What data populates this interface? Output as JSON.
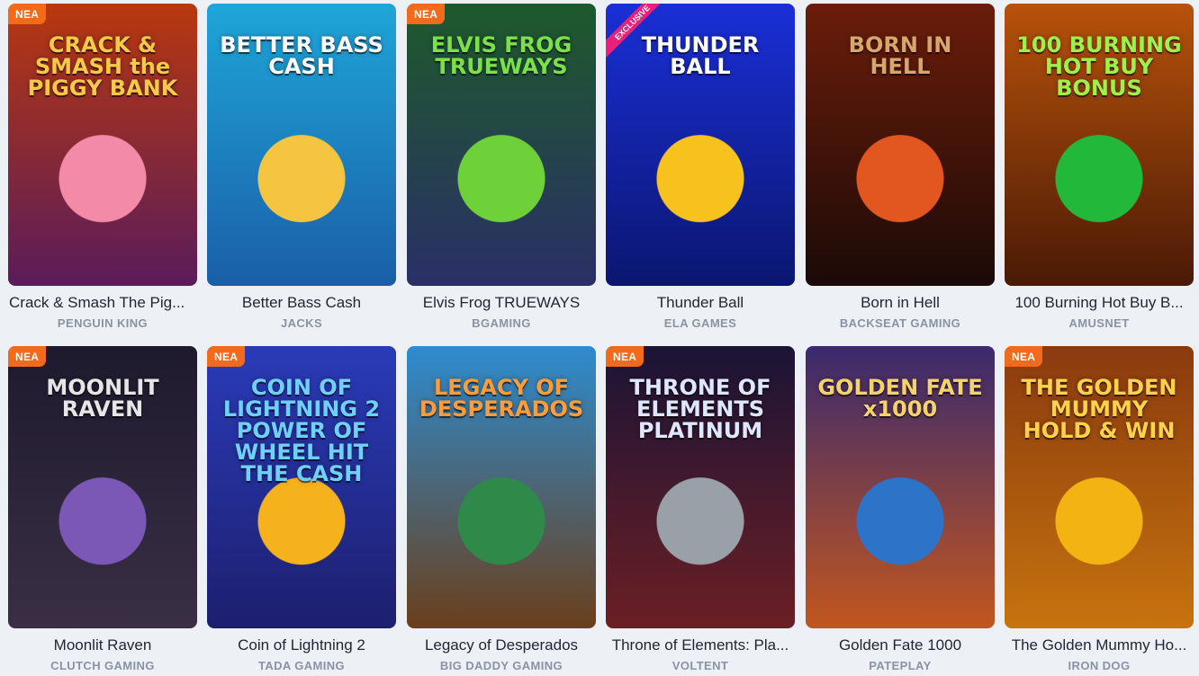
{
  "games": [
    {
      "title": "Crack & Smash The Pig...",
      "provider": "PENGUIN KING",
      "badge": "NEA",
      "ribbon": "",
      "logo": "CRACK & SMASH the PIGGY BANK",
      "logo_color": "#f7c948",
      "bg_top": "#b8380f",
      "bg_bottom": "#5a1c5a",
      "mark": "#f38aa8"
    },
    {
      "title": "Better Bass Cash",
      "provider": "JACKS",
      "badge": "",
      "ribbon": "",
      "logo": "BETTER BASS CASH",
      "logo_color": "#ffffff",
      "bg_top": "#1fa6d8",
      "bg_bottom": "#1a5ea8",
      "mark": "#f5c542"
    },
    {
      "title": "Elvis Frog TRUEWAYS",
      "provider": "BGAMING",
      "badge": "NEA",
      "ribbon": "",
      "logo": "ELVIS FROG TRUEWAYS",
      "logo_color": "#7be04a",
      "bg_top": "#1e5a2c",
      "bg_bottom": "#2a2f66",
      "mark": "#6fd13a"
    },
    {
      "title": "Thunder Ball",
      "provider": "ELA GAMES",
      "badge": "",
      "ribbon": "EXCLUSIVE",
      "logo": "THUNDER BALL",
      "logo_color": "#ffffff",
      "bg_top": "#1a2fd6",
      "bg_bottom": "#0b1670",
      "mark": "#f7c21e"
    },
    {
      "title": "Born in Hell",
      "provider": "BACKSEAT GAMING",
      "badge": "",
      "ribbon": "",
      "logo": "BORN IN HELL",
      "logo_color": "#d8a56b",
      "bg_top": "#6b1d0a",
      "bg_bottom": "#1b0a08",
      "mark": "#e2561f"
    },
    {
      "title": "100 Burning Hot Buy B...",
      "provider": "AMUSNET",
      "badge": "",
      "ribbon": "",
      "logo": "100 BURNING HOT BUY BONUS",
      "logo_color": "#9ef04a",
      "bg_top": "#b8520b",
      "bg_bottom": "#4a1a06",
      "mark": "#22b83a"
    },
    {
      "title": "Moonlit Raven",
      "provider": "CLUTCH GAMING",
      "badge": "NEA",
      "ribbon": "",
      "logo": "MOONLIT RAVEN",
      "logo_color": "#e6e6e6",
      "bg_top": "#1e1a2e",
      "bg_bottom": "#3a2f45",
      "mark": "#7b58b5"
    },
    {
      "title": "Coin of Lightning 2",
      "provider": "TADA GAMING",
      "badge": "NEA",
      "ribbon": "",
      "logo": "COIN OF LIGHTNING 2 POWER OF WHEEL HIT THE CASH",
      "logo_color": "#6fd0ff",
      "bg_top": "#2a3bb8",
      "bg_bottom": "#1d1f6e",
      "mark": "#f5b21d"
    },
    {
      "title": "Legacy of Desperados",
      "provider": "BIG DADDY GAMING",
      "badge": "",
      "ribbon": "",
      "logo": "LEGACY OF DESPERADOS",
      "logo_color": "#ff9c3a",
      "bg_top": "#2e8ccf",
      "bg_bottom": "#6a3f1c",
      "mark": "#2f8a4a"
    },
    {
      "title": "Throne of Elements: Pla...",
      "provider": "VOLTENT",
      "badge": "NEA",
      "ribbon": "",
      "logo": "THRONE OF ELEMENTS PLATINUM",
      "logo_color": "#dfe7ff",
      "bg_top": "#1b1436",
      "bg_bottom": "#6b1f24",
      "mark": "#9aa0a8"
    },
    {
      "title": "Golden Fate 1000",
      "provider": "PATEPLAY",
      "badge": "",
      "ribbon": "",
      "logo": "GOLDEN FATE x1000",
      "logo_color": "#f5d36b",
      "bg_top": "#3a2a6e",
      "bg_bottom": "#c2561f",
      "mark": "#2d74c9"
    },
    {
      "title": "The Golden Mummy Ho...",
      "provider": "IRON DOG",
      "badge": "NEA",
      "ribbon": "",
      "logo": "THE GOLDEN MUMMY HOLD & WIN",
      "logo_color": "#ffd24a",
      "bg_top": "#8a3a0e",
      "bg_bottom": "#c7730f",
      "mark": "#f2b313"
    }
  ]
}
